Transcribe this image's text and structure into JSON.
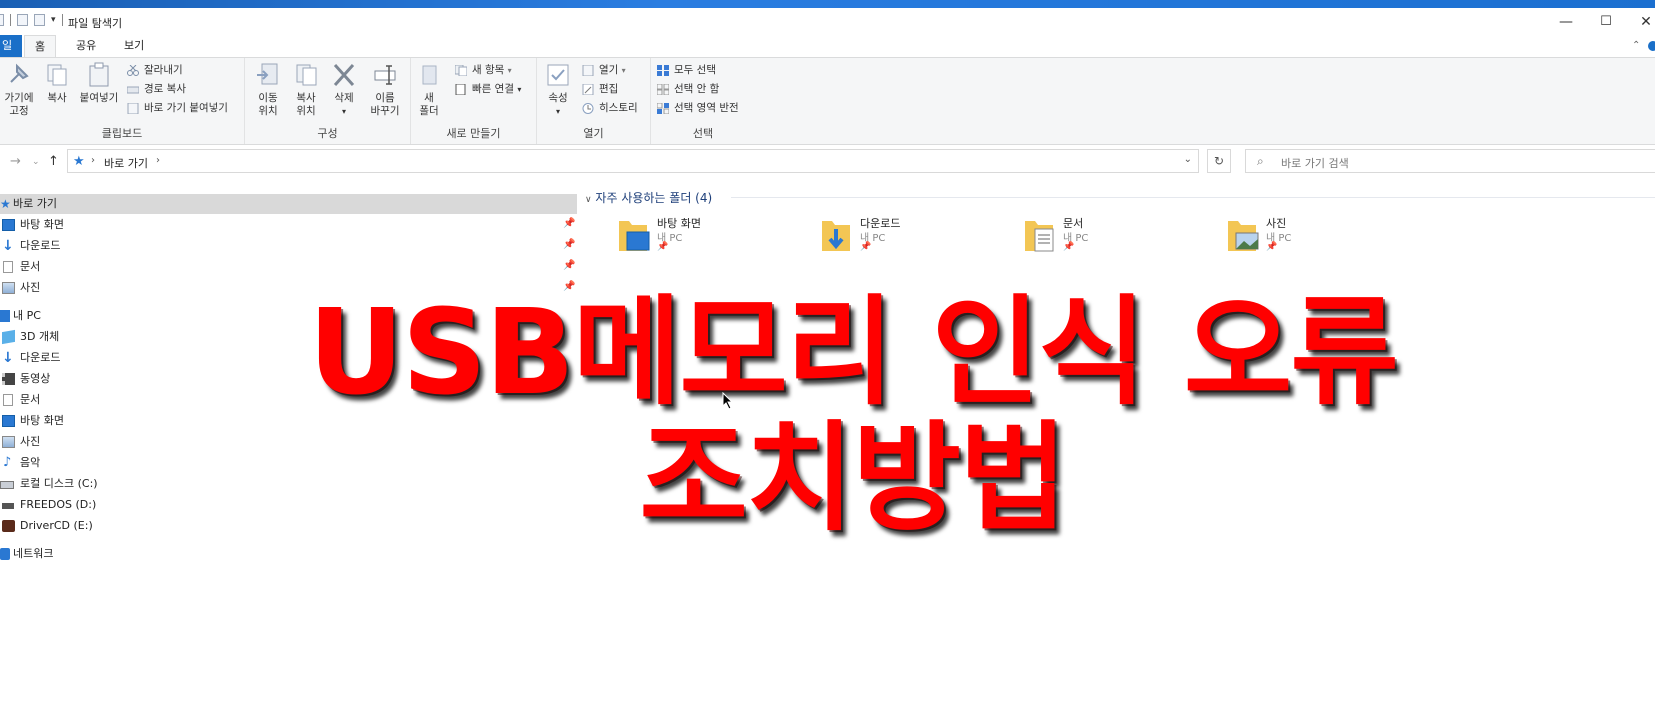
{
  "window": {
    "title": "파일 탐색기",
    "controls": {
      "minimize": "—",
      "maximize": "☐",
      "close": "✕"
    }
  },
  "ribbon_tabs": [
    {
      "label": "일"
    },
    {
      "label": "홈"
    },
    {
      "label": "공유"
    },
    {
      "label": "보기"
    }
  ],
  "ribbon": {
    "clipboard": {
      "label": "클립보드",
      "pin_line1": "가기에",
      "pin_line2": "고정",
      "copy": "복사",
      "paste": "붙여넣기",
      "cut": "잘라내기",
      "copy_path": "경로 복사",
      "paste_shortcut": "바로 가기 붙여넣기"
    },
    "organize": {
      "label": "구성",
      "move_line1": "이동",
      "move_line2": "위치",
      "copy_line1": "복사",
      "copy_line2": "위치",
      "delete": "삭제",
      "rename_line1": "이름",
      "rename_line2": "바꾸기"
    },
    "new": {
      "label": "새로 만들기",
      "new_folder_line1": "새",
      "new_folder_line2": "폴더",
      "new_item": "새 항목",
      "easy_access": "빠른 연결"
    },
    "open": {
      "label": "열기",
      "properties": "속성",
      "open": "열기",
      "edit": "편집",
      "history": "히스토리"
    },
    "select": {
      "label": "선택",
      "select_all": "모두 선택",
      "select_none": "선택 안 함",
      "invert": "선택 영역 반전"
    }
  },
  "address": {
    "crumb": "바로 가기",
    "search_placeholder": "바로 가기 검색"
  },
  "nav": {
    "quick_access": "바로 가기",
    "quick_items": [
      "바탕 화면",
      "다운로드",
      "문서",
      "사진"
    ],
    "this_pc": "내 PC",
    "pc_items": [
      "3D 개체",
      "다운로드",
      "동영상",
      "문서",
      "바탕 화면",
      "사진",
      "음악",
      "로컬 디스크 (C:)",
      "FREEDOS (D:)",
      "DriverCD (E:)"
    ],
    "network": "네트워크"
  },
  "content": {
    "section_title": "자주 사용하는 폴더 (4)",
    "folders": [
      {
        "name": "바탕 화면",
        "location": "내 PC"
      },
      {
        "name": "다운로드",
        "location": "내 PC"
      },
      {
        "name": "문서",
        "location": "내 PC"
      },
      {
        "name": "사진",
        "location": "내 PC"
      }
    ]
  },
  "overlay": {
    "line1": "USB메모리 인식 오류",
    "line2": "조치방법",
    "color": "#ff0000"
  }
}
